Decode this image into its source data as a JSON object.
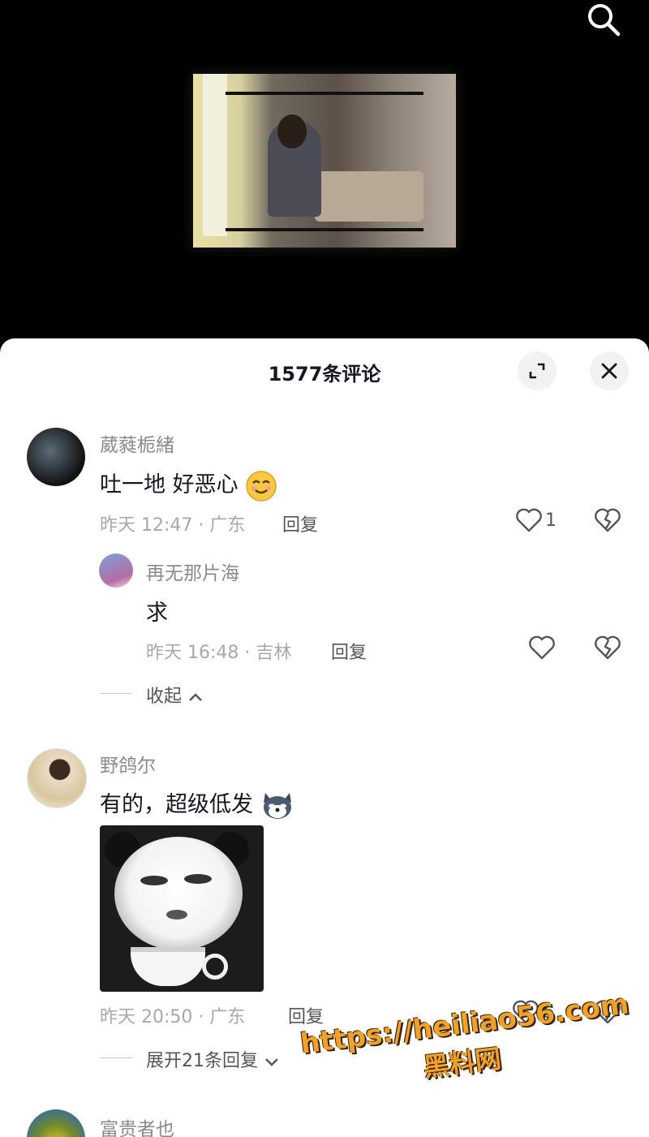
{
  "sheet": {
    "title": "1577条评论"
  },
  "comments": [
    {
      "user": "葳蕤栀緒",
      "text": "吐一地 好恶心",
      "emoji": "smile-emoji",
      "time_location": "昨天 12:47 · 广东",
      "reply_label": "回复",
      "likes": "1",
      "replies": [
        {
          "user": "再无那片海",
          "text": "求",
          "time_location": "昨天 16:48 · 吉林",
          "reply_label": "回复"
        }
      ],
      "collapse_label": "收起"
    },
    {
      "user": "野鸽尔",
      "text": "有的，超级低发",
      "emoji": "husky-emoji",
      "sticker": "panda-meme-sticker",
      "time_location": "昨天 20:50 · 广东",
      "reply_label": "回复",
      "likes": "5",
      "expand_label": "展开21条回复"
    },
    {
      "user": "富贵者也"
    }
  ],
  "watermark": {
    "url": "https://heiliao56.com",
    "name": "黑料网"
  },
  "colors": {
    "watermark": "#f0a12a",
    "sheet_bg": "#ffffff",
    "muted_text": "#a7a8ad"
  }
}
